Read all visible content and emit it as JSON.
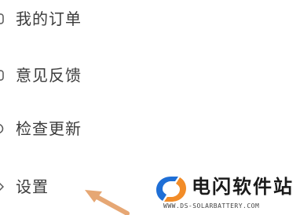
{
  "menu": {
    "items": [
      {
        "label": "我的订单",
        "icon": "orders-icon"
      },
      {
        "label": "意见反馈",
        "icon": "feedback-icon"
      },
      {
        "label": "检查更新",
        "icon": "update-icon"
      },
      {
        "label": "设置",
        "icon": "settings-icon"
      }
    ]
  },
  "watermark": {
    "title": "电闪软件站",
    "url": "WWW.DS-SOLARBATTERY.COM",
    "colors": {
      "blue": "#1f6fd6",
      "orange": "#f28c28"
    }
  },
  "annotation": {
    "arrow_color": "#e6a774"
  }
}
